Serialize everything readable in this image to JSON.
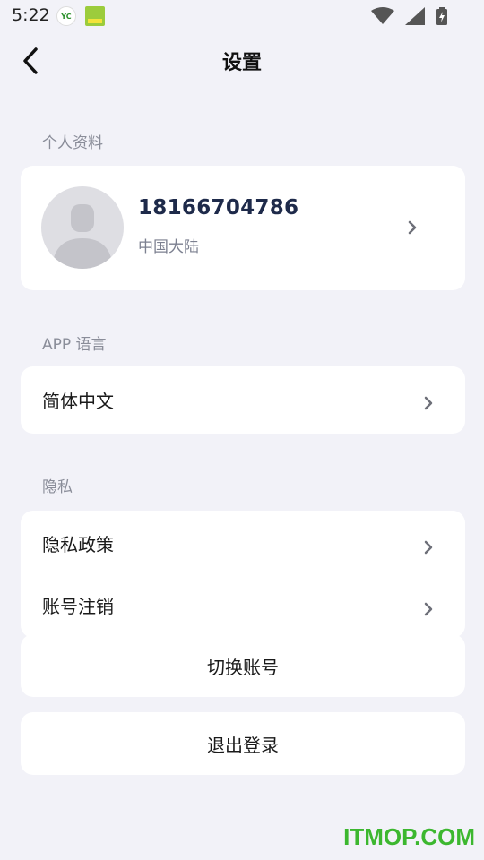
{
  "status_bar": {
    "time": "5:22"
  },
  "header": {
    "title": "设置"
  },
  "profile_section": {
    "label": "个人资料",
    "phone": "18166704786",
    "region": "中国大陆"
  },
  "language_section": {
    "label": "APP 语言",
    "value": "简体中文"
  },
  "privacy_section": {
    "label": "隐私",
    "items": [
      {
        "label": "隐私政策"
      },
      {
        "label": "账号注销"
      }
    ]
  },
  "actions": {
    "switch_account": "切换账号",
    "logout": "退出登录"
  },
  "watermark": "ITMOP.COM",
  "colors": {
    "background": "#f2f2f8",
    "card": "#ffffff",
    "section_label": "#8a8d99",
    "phone_text": "#1e2a4a",
    "watermark": "#3cb72f"
  }
}
